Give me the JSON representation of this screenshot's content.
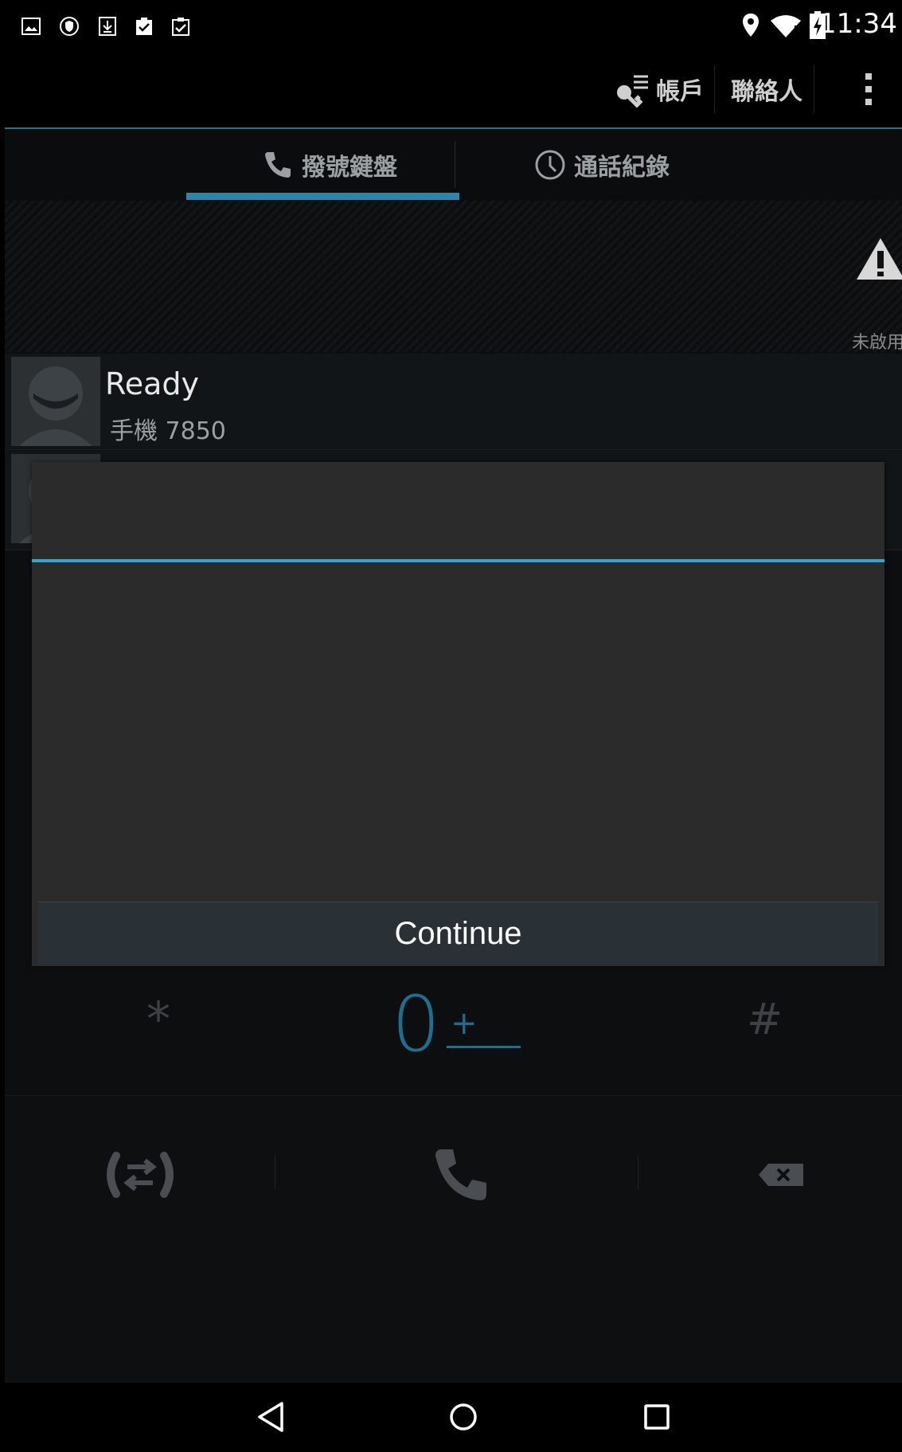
{
  "status_bar": {
    "time": "11:34",
    "left_icons": [
      "image-icon",
      "shield-icon",
      "download-icon",
      "clipboard-check-icon",
      "clipboard-upload-icon"
    ],
    "right_icons": [
      "location-icon",
      "wifi-icon",
      "battery-charging-icon"
    ]
  },
  "action_bar": {
    "accounts_label": "帳戶",
    "contacts_label": "聯絡人"
  },
  "tabs": [
    {
      "label": "撥號鍵盤",
      "selected": true
    },
    {
      "label": "通話紀錄",
      "selected": false
    }
  ],
  "warning": {
    "label": "未啟用"
  },
  "contacts": [
    {
      "name": "Ready",
      "detail": "手機 7850"
    }
  ],
  "dialpad": {
    "star": "*",
    "zero": "0",
    "plus": "+",
    "hash": "#"
  },
  "dialog": {
    "button_label": "Continue"
  },
  "colors": {
    "accent": "#33a6cf",
    "tab_indicator": "#2d86a8",
    "dialog_bg": "#2b2b2b",
    "screen_bg": "#0c0e10"
  }
}
